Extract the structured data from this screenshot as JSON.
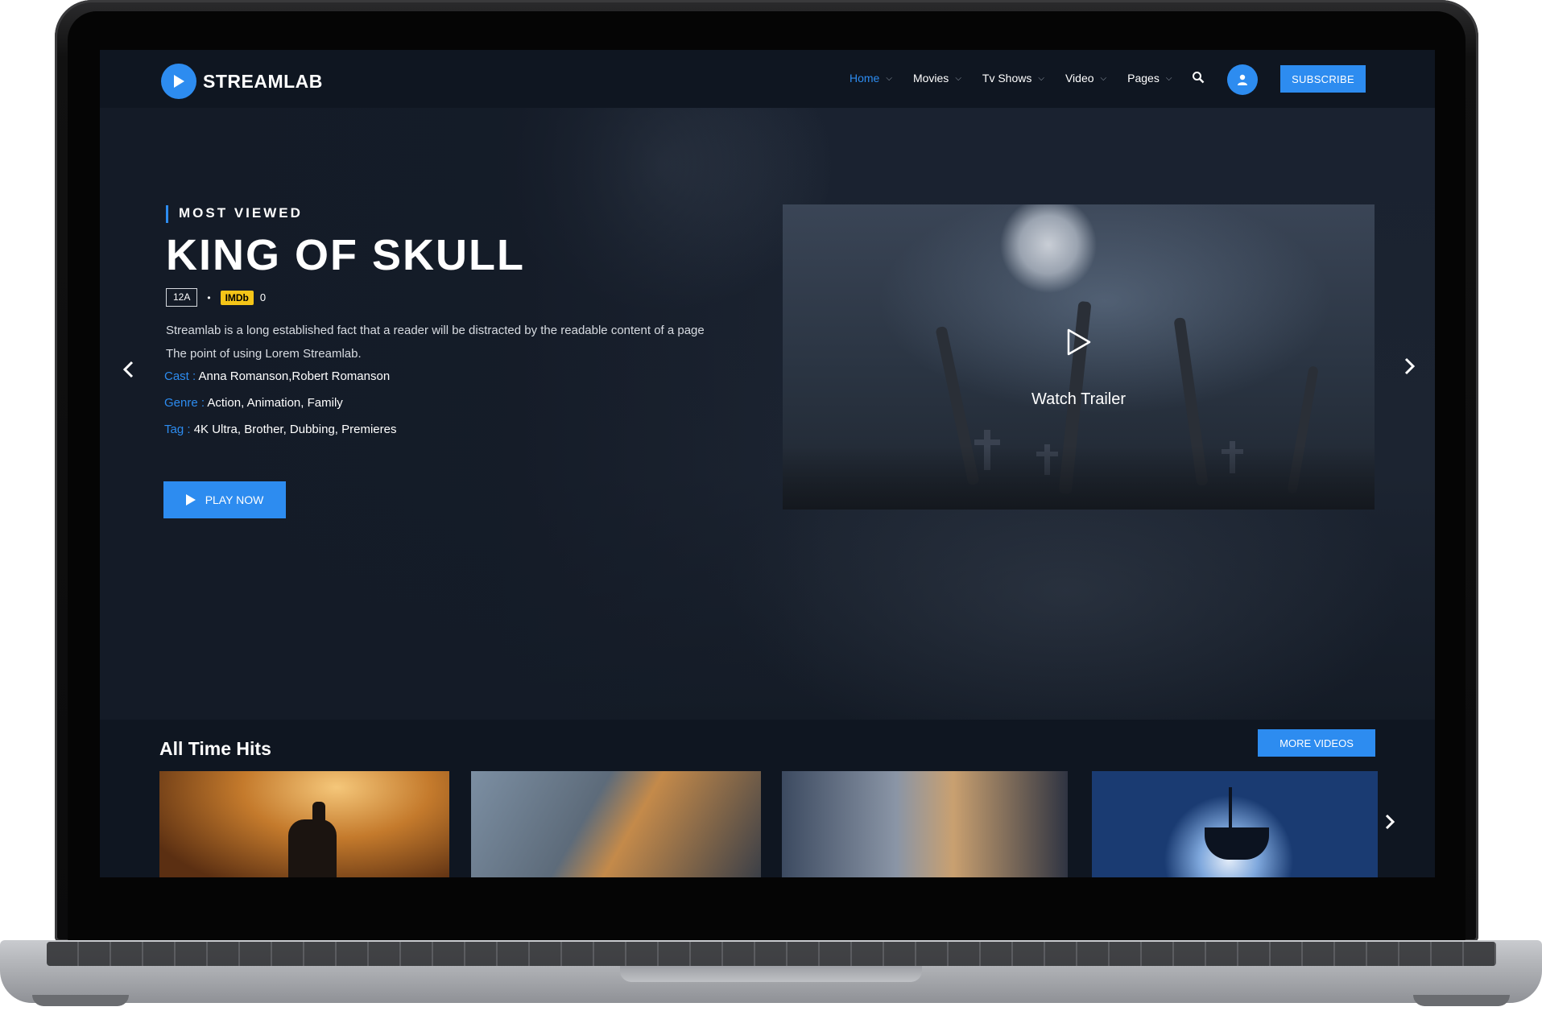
{
  "nav": {
    "logo_text": "STREAMLAB",
    "items": [
      {
        "label": "Home",
        "active": true
      },
      {
        "label": "Movies",
        "active": false
      },
      {
        "label": "Tv Shows",
        "active": false
      },
      {
        "label": "Video",
        "active": false
      },
      {
        "label": "Pages",
        "active": false
      }
    ],
    "subscribe_label": "SUBSCRIBE"
  },
  "hero": {
    "label": "MOST VIEWED",
    "title": "KING OF SKULL",
    "rating": "12A",
    "dot": "•",
    "imdb_badge": "IMDb",
    "imdb_value": "0",
    "description_line1": "Streamlab is a long established fact that a reader will be distracted by the readable content of a page",
    "description_line2": "The point of using Lorem Streamlab.",
    "cast_key": "Cast :",
    "cast_value": "Anna Romanson,Robert Romanson",
    "genre_key": "Genre :",
    "genre_value": "Action, Animation, Family",
    "tag_key": "Tag :",
    "tag_value": "4K Ultra, Brother, Dubbing, Premieres",
    "play_label": "PLAY NOW",
    "trailer_label": "Watch Trailer"
  },
  "section": {
    "title": "All Time Hits",
    "more_label": "MORE VIDEOS"
  },
  "colors": {
    "accent": "#2d8cf0",
    "background": "#0f1621",
    "imdb": "#f5c518"
  },
  "icons": [
    "play-icon",
    "search-icon",
    "user-icon",
    "chevron-left-icon",
    "chevron-right-icon",
    "chevron-down-icon"
  ]
}
